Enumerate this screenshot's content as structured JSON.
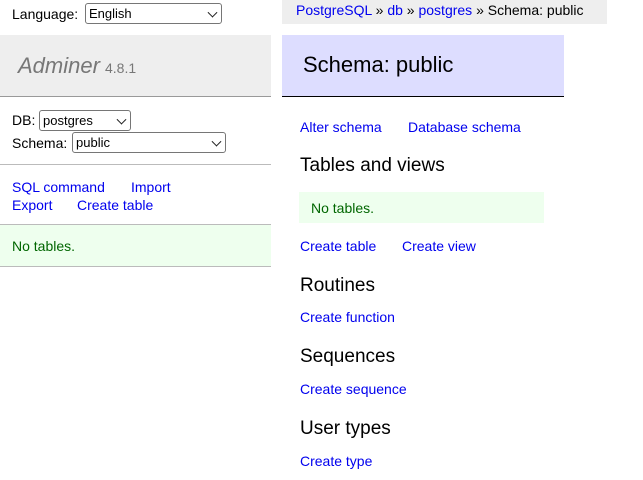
{
  "language": {
    "label": "Language:",
    "selected": "English"
  },
  "logo": {
    "name": "Adminer",
    "version": "4.8.1"
  },
  "db": {
    "label": "DB:",
    "selected": "postgres"
  },
  "schema": {
    "label": "Schema:",
    "selected": "public"
  },
  "menu_links": {
    "sql_command": "SQL command",
    "import": "Import",
    "export": "Export",
    "create_table": "Create table"
  },
  "left_message": "No tables.",
  "breadcrumb": {
    "server": "PostgreSQL",
    "sep": "»",
    "db": "db",
    "database": "postgres",
    "current": "Schema: public"
  },
  "page_title": "Schema: public",
  "schema_links": {
    "alter_schema": "Alter schema",
    "database_schema": "Database schema"
  },
  "tables_section": {
    "heading": "Tables and views",
    "message": "No tables.",
    "create_table": "Create table",
    "create_view": "Create view"
  },
  "routines_section": {
    "heading": "Routines",
    "create_function": "Create function"
  },
  "sequences_section": {
    "heading": "Sequences",
    "create_sequence": "Create sequence"
  },
  "user_types_section": {
    "heading": "User types",
    "create_type": "Create type"
  },
  "colors": {
    "link": "#0000ee",
    "menu_bg": "#eeeeee",
    "title_bg": "#ddddff",
    "message_bg": "#eeffee",
    "message_text": "#006600",
    "logo_text": "#777777"
  }
}
